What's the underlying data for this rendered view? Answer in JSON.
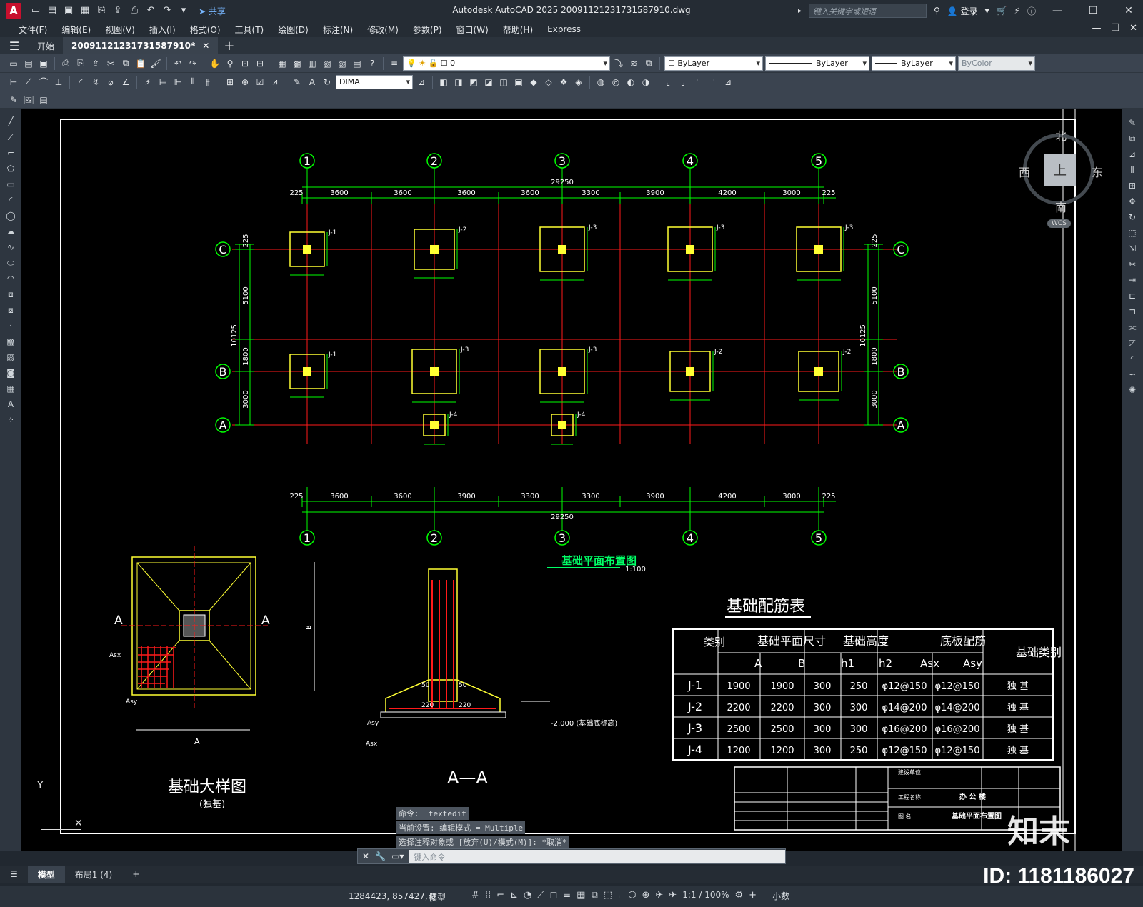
{
  "app": {
    "logo": "A",
    "title": "Autodesk AutoCAD 2025   20091121231731587910.dwg",
    "share_label": "共享",
    "search_placeholder": "键入关键字或短语",
    "login_label": "登录"
  },
  "menu": [
    "文件(F)",
    "编辑(E)",
    "视图(V)",
    "插入(I)",
    "格式(O)",
    "工具(T)",
    "绘图(D)",
    "标注(N)",
    "修改(M)",
    "参数(P)",
    "窗口(W)",
    "帮助(H)",
    "Express"
  ],
  "tabs": {
    "start": "开始",
    "document": "20091121231731587910*"
  },
  "toolbar": {
    "layer_value": "0",
    "color": "ByLayer",
    "linetype": "ByLayer",
    "lineweight": "ByLayer",
    "plotstyle": "ByColor",
    "dimstyle": "DIMA"
  },
  "viewcube": {
    "north": "北",
    "south": "南",
    "east": "东",
    "west": "西",
    "face": "上",
    "wcs": "WCS"
  },
  "drawing": {
    "plan_title": "基础平面布置图",
    "plan_scale": "1:100",
    "total_dim": "29250",
    "top_dims": [
      "225",
      "3600",
      "3600",
      "3600",
      "3600",
      "3300",
      "3900",
      "4200",
      "3000",
      "225"
    ],
    "bottom_dims": [
      "225",
      "3600",
      "3600",
      "3900",
      "3300",
      "3300",
      "3900",
      "4200",
      "3000",
      "225"
    ],
    "grid_numbers": [
      "1",
      "2",
      "3",
      "4",
      "5"
    ],
    "grid_letters": [
      "C",
      "B",
      "A"
    ],
    "left_dims": [
      "225",
      "5100",
      "10125",
      "1800",
      "3000"
    ],
    "detail_title": "基础大样图",
    "detail_subtitle": "(独基)",
    "section_title": "A—A",
    "section_level": "-2.000 (基础底标高)",
    "table_title": "基础配筋表",
    "table_headers": {
      "type": "类别",
      "plan_size": "基础平面尺寸",
      "height": "基础高度",
      "rebar": "底板配筋",
      "kind": "基础类别",
      "a": "A",
      "b": "B",
      "h1": "h1",
      "h2": "h2",
      "asx": "Asx",
      "asy": "Asy"
    },
    "table_rows": [
      [
        "J-1",
        "1900",
        "1900",
        "300",
        "250",
        "φ12@150",
        "φ12@150",
        "独 基"
      ],
      [
        "J-2",
        "2200",
        "2200",
        "300",
        "300",
        "φ14@200",
        "φ14@200",
        "独 基"
      ],
      [
        "J-3",
        "2500",
        "2500",
        "300",
        "300",
        "φ16@200",
        "φ16@200",
        "独 基"
      ],
      [
        "J-4",
        "1200",
        "1200",
        "300",
        "250",
        "φ12@150",
        "φ12@150",
        "独 基"
      ]
    ],
    "titleblock": {
      "project": "办 公 楼",
      "drawing_name": "基础平面布置图",
      "owner": "建设单位",
      "project_label": "工程名称",
      "drawing_label": "图 名"
    }
  },
  "command": {
    "history": [
      "命令: _textedit",
      "当前设置: 编辑模式 = Multiple",
      "选择注释对象或 [放弃(U)/模式(M)]: *取消*"
    ],
    "placeholder": "键入命令"
  },
  "layout_tabs": [
    "模型",
    "布局1 (4)"
  ],
  "status": {
    "coords": "1284423, 857427, 0",
    "model": "模型",
    "scale": "1:1 / 100%",
    "units": "小数"
  },
  "watermark": {
    "id": "ID: 1181186027",
    "brand": "知末"
  }
}
